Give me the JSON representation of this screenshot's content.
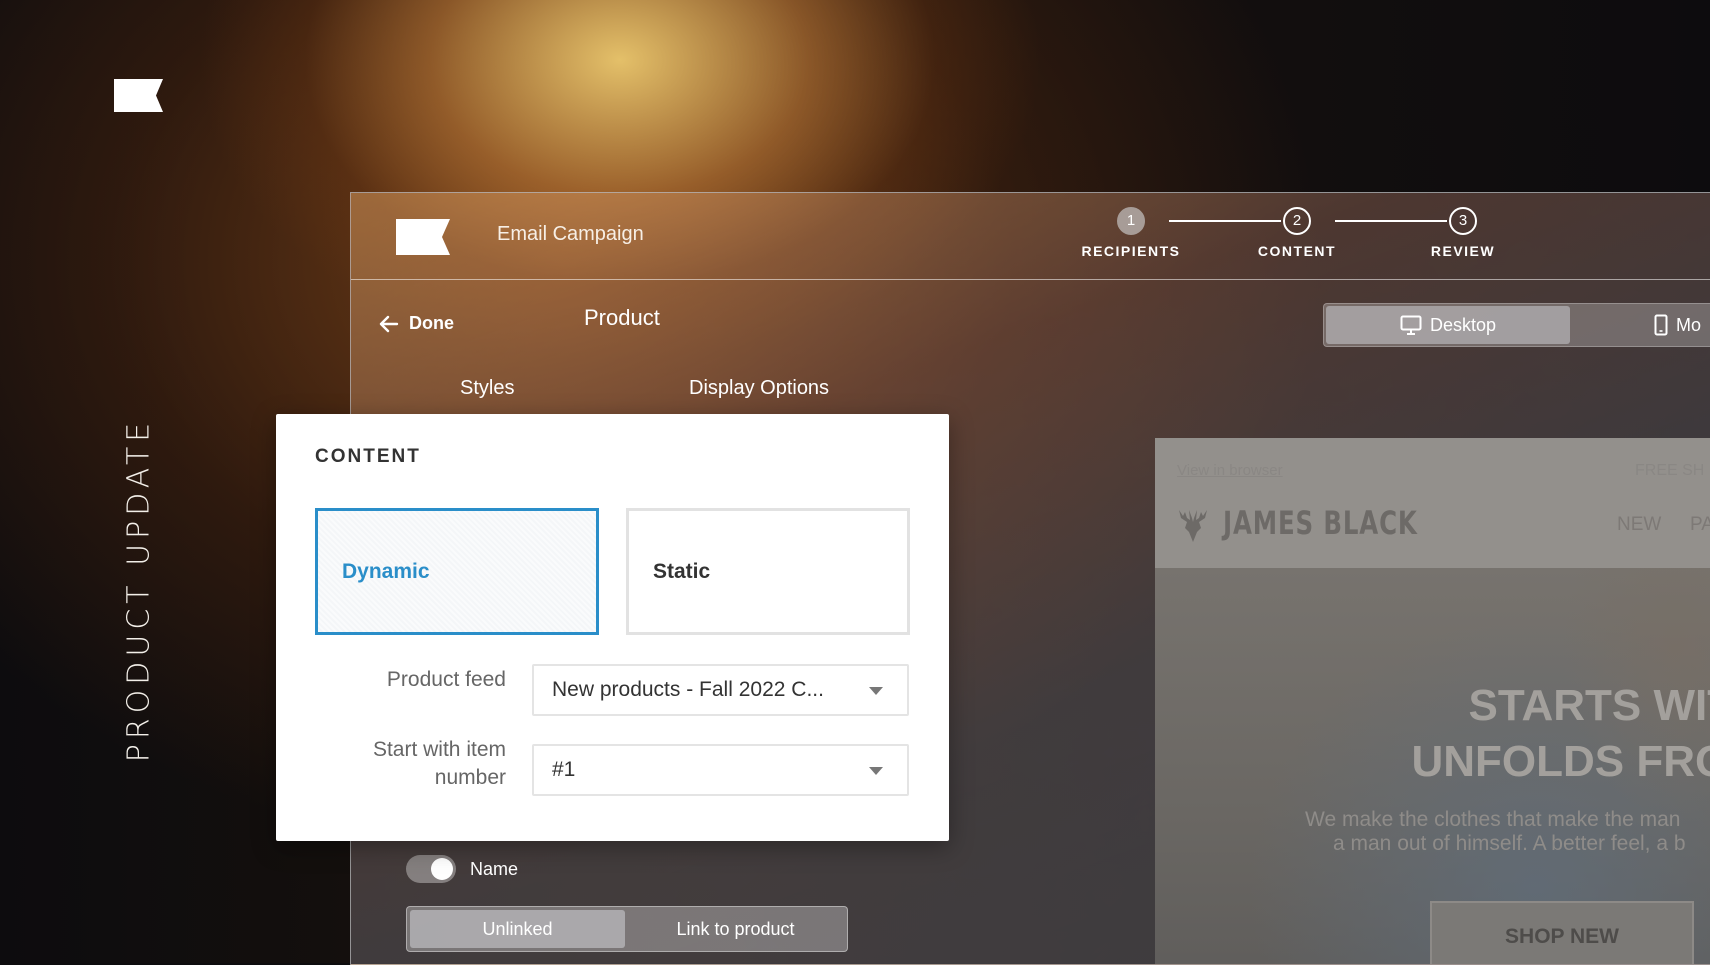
{
  "brand": {
    "side_title": "PRODUCT UPDATE"
  },
  "app": {
    "title": "Email Campaign",
    "steps": [
      {
        "number": "1",
        "label": "RECIPIENTS"
      },
      {
        "number": "2",
        "label": "CONTENT"
      },
      {
        "number": "3",
        "label": "REVIEW"
      }
    ],
    "done_label": "Done",
    "panel_title": "Product",
    "tabs": {
      "styles": "Styles",
      "display_options": "Display Options"
    },
    "device_toggle": {
      "desktop": "Desktop",
      "mobile": "Mo"
    },
    "name_toggle_label": "Name",
    "link_segment": {
      "unlinked": "Unlinked",
      "link_to_product": "Link to product"
    }
  },
  "preview": {
    "view_in_browser": "View in browser",
    "free_shipping": "FREE SH",
    "brand_name": "JAMES BLACK",
    "nav": {
      "new": "NEW",
      "pa": "PA"
    },
    "headline_1": "STARTS WITH F",
    "headline_2": "UNFOLDS FROM T",
    "sub_1": "We make the clothes that make the man",
    "sub_2": "a man out of himself. A better feel, a b",
    "shop_button": "SHOP NEW"
  },
  "popup": {
    "title": "CONTENT",
    "options": {
      "dynamic": "Dynamic",
      "static": "Static"
    },
    "product_feed_label": "Product feed",
    "product_feed_value": "New products - Fall 2022 C...",
    "start_item_label_1": "Start with item",
    "start_item_label_2": "number",
    "start_item_value": "#1"
  },
  "colors": {
    "accent_blue": "#2a8ec9",
    "background": "#0d0c0e"
  }
}
